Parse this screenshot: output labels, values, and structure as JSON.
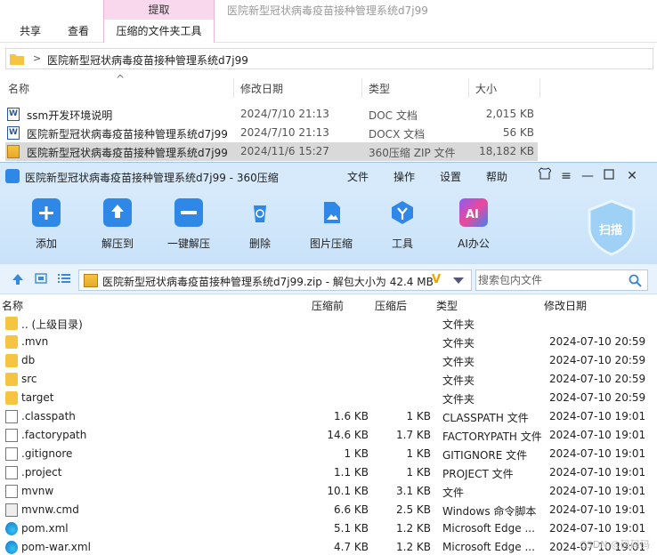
{
  "explorer": {
    "context_group": "提取",
    "tabs": [
      "共享",
      "查看",
      "压缩的文件夹工具"
    ],
    "window_title": "医院新型冠状病毒疫苗接种管理系统d7j99",
    "address": "医院新型冠状病毒疫苗接种管理系统d7j99",
    "columns": {
      "name": "名称",
      "date": "修改日期",
      "type": "类型",
      "size": "大小"
    },
    "files": [
      {
        "name": "ssm开发环境说明",
        "date": "2024/7/10 21:13",
        "type": "DOC 文档",
        "size": "2,015 KB",
        "icon": "word-doc-icon"
      },
      {
        "name": "医院新型冠状病毒疫苗接种管理系统d7j99",
        "date": "2024/7/10 21:13",
        "type": "DOCX 文档",
        "size": "56 KB",
        "icon": "word-doc-icon"
      },
      {
        "name": "医院新型冠状病毒疫苗接种管理系统d7j99",
        "date": "2024/11/6 15:27",
        "type": "360压缩 ZIP 文件",
        "size": "18,182 KB",
        "icon": "zip-archive-icon",
        "selected": true
      }
    ]
  },
  "zipwin": {
    "title": "医院新型冠状病毒疫苗接种管理系统d7j99 - 360压缩",
    "menu": [
      "文件",
      "操作",
      "设置",
      "帮助"
    ],
    "tools": [
      "添加",
      "解压到",
      "一键解压",
      "删除",
      "图片压缩",
      "工具",
      "AI办公"
    ],
    "scan_label": "扫描",
    "path_text": "医院新型冠状病毒疫苗接种管理系统d7j99.zip - 解包大小为 42.4 MB",
    "search_placeholder": "搜索包内文件",
    "columns": {
      "name": "名称",
      "before": "压缩前",
      "after": "压缩后",
      "type": "类型",
      "date": "修改日期"
    },
    "entries": [
      {
        "name": ".. (上级目录)",
        "before": "",
        "after": "",
        "type": "文件夹",
        "date": "",
        "icon": "folder-icon"
      },
      {
        "name": ".mvn",
        "before": "",
        "after": "",
        "type": "文件夹",
        "date": "2024-07-10 20:59",
        "icon": "folder-icon"
      },
      {
        "name": "db",
        "before": "",
        "after": "",
        "type": "文件夹",
        "date": "2024-07-10 20:59",
        "icon": "folder-icon"
      },
      {
        "name": "src",
        "before": "",
        "after": "",
        "type": "文件夹",
        "date": "2024-07-10 20:59",
        "icon": "folder-icon"
      },
      {
        "name": "target",
        "before": "",
        "after": "",
        "type": "文件夹",
        "date": "2024-07-10 20:59",
        "icon": "folder-icon"
      },
      {
        "name": ".classpath",
        "before": "1.6 KB",
        "after": "1 KB",
        "type": "CLASSPATH 文件",
        "date": "2024-07-10 19:01",
        "icon": "file-icon"
      },
      {
        "name": ".factorypath",
        "before": "14.6 KB",
        "after": "1.7 KB",
        "type": "FACTORYPATH 文件",
        "date": "2024-07-10 19:01",
        "icon": "file-icon"
      },
      {
        "name": ".gitignore",
        "before": "1 KB",
        "after": "1 KB",
        "type": "GITIGNORE 文件",
        "date": "2024-07-10 19:01",
        "icon": "file-icon"
      },
      {
        "name": ".project",
        "before": "1.1 KB",
        "after": "1 KB",
        "type": "PROJECT 文件",
        "date": "2024-07-10 19:01",
        "icon": "file-icon"
      },
      {
        "name": "mvnw",
        "before": "10.1 KB",
        "after": "3.1 KB",
        "type": "文件",
        "date": "2024-07-10 19:01",
        "icon": "file-icon"
      },
      {
        "name": "mvnw.cmd",
        "before": "6.6 KB",
        "after": "2.5 KB",
        "type": "Windows 命令脚本",
        "date": "2024-07-10 19:01",
        "icon": "cmd-script-icon"
      },
      {
        "name": "pom.xml",
        "before": "5.1 KB",
        "after": "1.2 KB",
        "type": "Microsoft Edge ...",
        "date": "2024-07-10 19:01",
        "icon": "edge-icon"
      },
      {
        "name": "pom-war.xml",
        "before": "4.7 KB",
        "after": "1.2 KB",
        "type": "Microsoft Edge ...",
        "date": "2024-07-10 19:01",
        "icon": "edge-icon"
      }
    ]
  },
  "watermark": "CSDN @码码码",
  "colors": {
    "accent": "#2f88e8",
    "context_tab": "#f9d7ec",
    "toolbar_bg": "#d6eafb",
    "folder": "#f5c542"
  }
}
